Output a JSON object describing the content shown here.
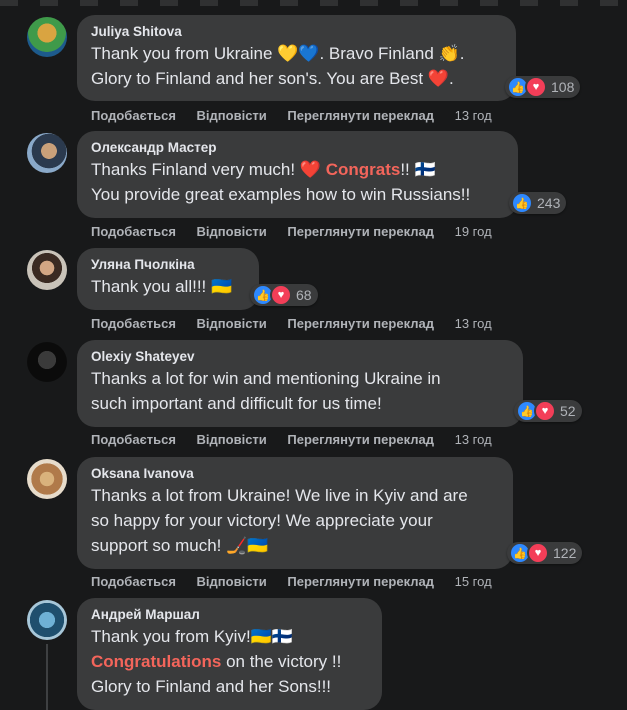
{
  "actions": {
    "like": "Подобається",
    "reply": "Відповісти",
    "translate": "Переглянути переклад"
  },
  "comments": [
    {
      "author": "Juliya Shitova",
      "lines": [
        "Thank you from Ukraine 💛💙. Bravo Finland 👏.",
        "Glory to Finland and her son's. You are Best ❤️."
      ],
      "reactions": "108",
      "time": "13 год"
    },
    {
      "author": "Олександр Мастер",
      "line1_pre": "Thanks Finland very much! ❤️ ",
      "line1_hl": "Congrats",
      "line1_post": "!! 🇫🇮",
      "line2": "You provide great examples how to win Russians!!",
      "reactions": "243",
      "time": "19 год"
    },
    {
      "author": "Уляна Пчолкіна",
      "lines": [
        "Thank you all!!! 🇺🇦"
      ],
      "reactions": "68",
      "time": "13 год"
    },
    {
      "author": "Olexiy Shateyev",
      "lines": [
        "Thanks a lot for win and mentioning Ukraine in",
        "such important and difficult for us time!"
      ],
      "reactions": "52",
      "time": "13 год"
    },
    {
      "author": "Oksana Ivanova",
      "lines": [
        "Thanks a lot from Ukraine! We live in Kyiv and are",
        "so happy for your victory! We appreciate your",
        "support so much! 🏒🇺🇦"
      ],
      "reactions": "122",
      "time": "15 год"
    },
    {
      "author": "Андрей Маршал",
      "line1": "Thank you from Kyiv!🇺🇦🇫🇮",
      "line2_hl": "Congratulations",
      "line2_post": " on the victory !!",
      "line3": "Glory to Finland and her Sons!!!"
    }
  ],
  "colors": {
    "background": "#18191a",
    "bubble": "#3a3b3c",
    "highlight": "#f3655b",
    "like": "#2e89ff",
    "love": "#f33e58",
    "secondary_text": "#b0b3b8"
  }
}
